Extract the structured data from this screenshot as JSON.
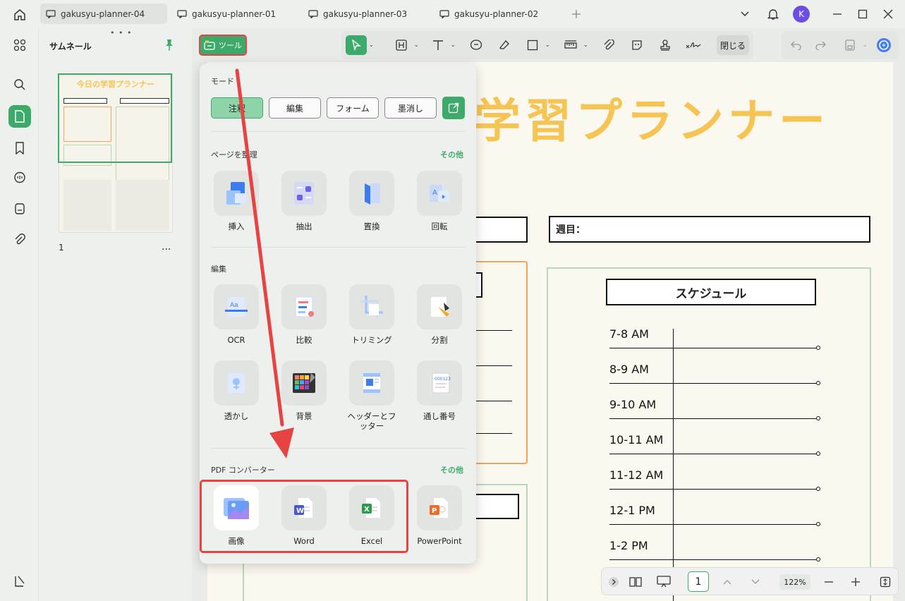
{
  "tabs": [
    {
      "label": "gakusyu-planner-04",
      "active": true
    },
    {
      "label": "gakusyu-planner-01",
      "active": false
    },
    {
      "label": "gakusyu-planner-03",
      "active": false
    },
    {
      "label": "gakusyu-planner-02",
      "active": false
    }
  ],
  "user": {
    "initial": "K"
  },
  "thumbnails": {
    "title": "サムネール",
    "page_number": "1",
    "more": "...",
    "thumb_title": "今日の学習プランナー"
  },
  "toolbar": {
    "tool_label": "ツール",
    "close_label": "閉じる"
  },
  "document": {
    "title": "学習プランナー",
    "week_label": "週目：",
    "schedule_title": "スケジュール",
    "times": [
      "7-8 AM",
      "8-9 AM",
      "9-10  AM",
      "10-11  AM",
      "11-12  AM",
      "12-1  PM",
      "1-2  PM"
    ]
  },
  "statusbar": {
    "page": "1",
    "zoom": "122%"
  },
  "dropdown": {
    "mode_title": "モード",
    "modes": [
      "注釈",
      "編集",
      "フォーム",
      "墨消し"
    ],
    "organize": {
      "title": "ページを整理",
      "more": "その他",
      "items": [
        "挿入",
        "抽出",
        "置換",
        "回転"
      ]
    },
    "edit": {
      "title": "編集",
      "items": [
        "OCR",
        "比較",
        "トリミング",
        "分割",
        "透かし",
        "背景",
        "ヘッダーとフッター",
        "通し番号"
      ]
    },
    "converter": {
      "title": "PDF コンバーター",
      "more": "その他",
      "items": [
        "画像",
        "Word",
        "Excel",
        "PowerPoint"
      ]
    }
  },
  "colors": {
    "accent": "#3daa6b",
    "highlight": "#e64343",
    "title_yellow": "#f6c453"
  }
}
